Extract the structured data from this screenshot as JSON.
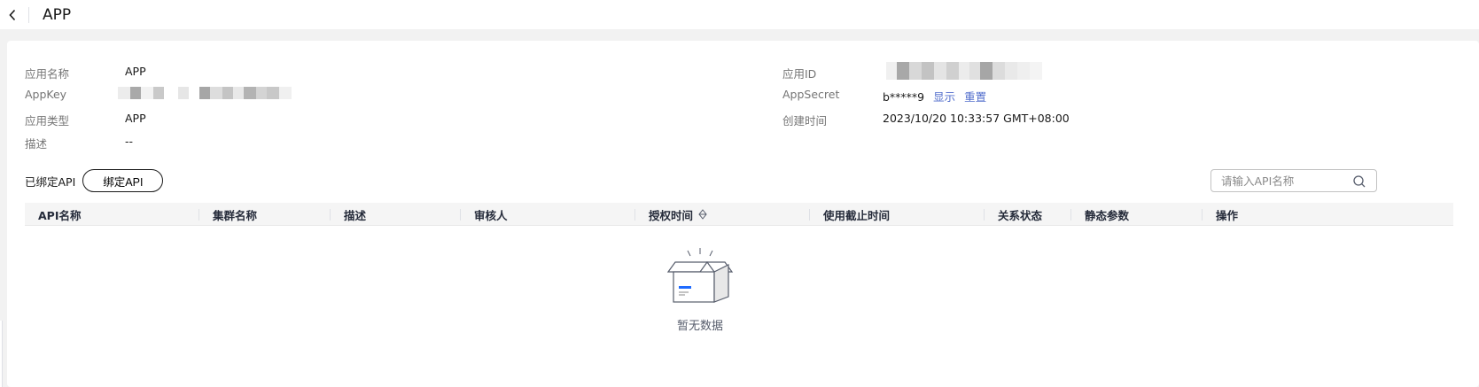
{
  "header": {
    "title": "APP"
  },
  "details": {
    "app_name_label": "应用名称",
    "app_name": "APP",
    "appkey_label": "AppKey",
    "app_type_label": "应用类型",
    "app_type": "APP",
    "description_label": "描述",
    "description": "--",
    "app_id_label": "应用ID",
    "appsecret_label": "AppSecret",
    "appsecret": "b*****9",
    "show_link": "显示",
    "reset_link": "重置",
    "created_label": "创建时间",
    "created": "2023/10/20 10:33:57 GMT+08:00"
  },
  "bound_api": {
    "label": "已绑定API",
    "bind_button": "绑定API",
    "search_placeholder": "请输入API名称"
  },
  "table": {
    "columns": [
      "API名称",
      "集群名称",
      "描述",
      "审核人",
      "授权时间",
      "使用截止时间",
      "关系状态",
      "静态参数",
      "操作"
    ],
    "rows": [],
    "empty_text": "暂无数据"
  },
  "icons": {
    "back": "chevron-left-icon",
    "search": "search-icon",
    "sort": "sort-icon",
    "empty": "empty-box-icon"
  },
  "colors": {
    "link": "#526ecc",
    "accent": "#1f6bff"
  }
}
